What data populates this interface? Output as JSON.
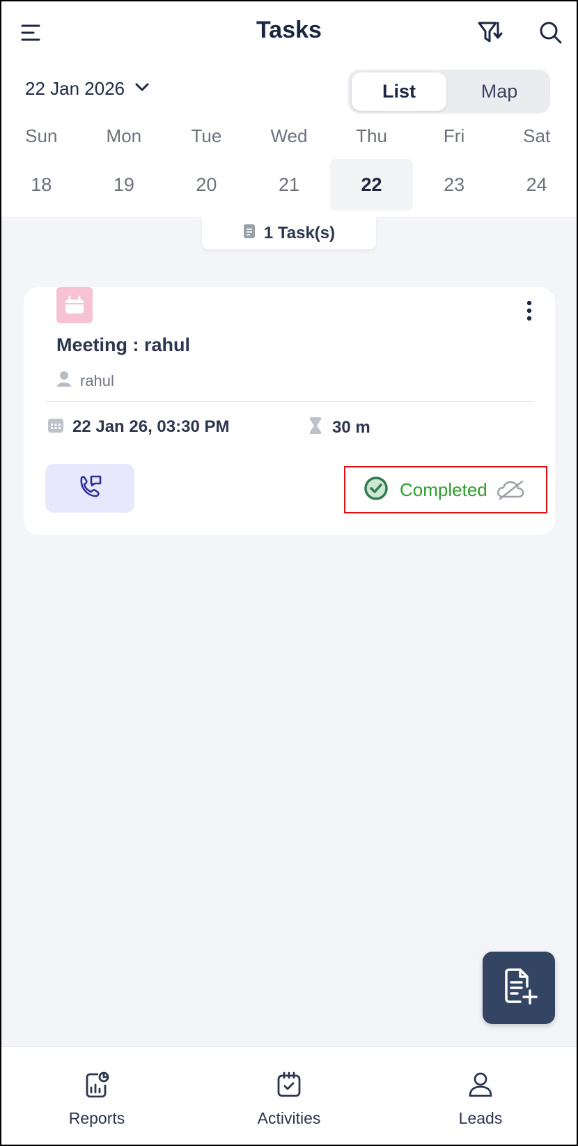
{
  "header": {
    "title": "Tasks",
    "menu_icon": "hamburger-menu-icon",
    "filter_icon": "filter-sort-icon",
    "search_icon": "search-icon"
  },
  "date_picker": {
    "label": "22 Jan 2026",
    "icon": "chevron-down-icon"
  },
  "view_toggle": {
    "list": "List",
    "map": "Map",
    "selected": "List"
  },
  "week": {
    "days": [
      "Sun",
      "Mon",
      "Tue",
      "Wed",
      "Thu",
      "Fri",
      "Sat"
    ],
    "dates": [
      "18",
      "19",
      "20",
      "21",
      "22",
      "23",
      "24"
    ],
    "selected": "22"
  },
  "task_count": {
    "label": "1 Task(s)",
    "icon": "document-icon"
  },
  "task": {
    "type_icon": "calendar-meeting-icon",
    "title": "Meeting : rahul",
    "owner": "rahul",
    "datetime": "22 Jan 26, 03:30 PM",
    "duration": "30 m",
    "status": "Completed",
    "call_icon": "phone-message-icon",
    "sync_icon": "cloud-off-icon"
  },
  "fab": {
    "icon": "add-task-icon"
  },
  "bottom_nav": {
    "items": [
      {
        "label": "Reports",
        "icon": "reports-icon"
      },
      {
        "label": "Activities",
        "icon": "activities-calendar-icon"
      },
      {
        "label": "Leads",
        "icon": "leads-person-icon"
      }
    ]
  },
  "colors": {
    "accent_dark": "#344563",
    "status_green": "#2ca02c",
    "highlight_red": "#e01010",
    "meeting_pink": "#f7c2d4",
    "call_bg": "#e7e8fb"
  }
}
